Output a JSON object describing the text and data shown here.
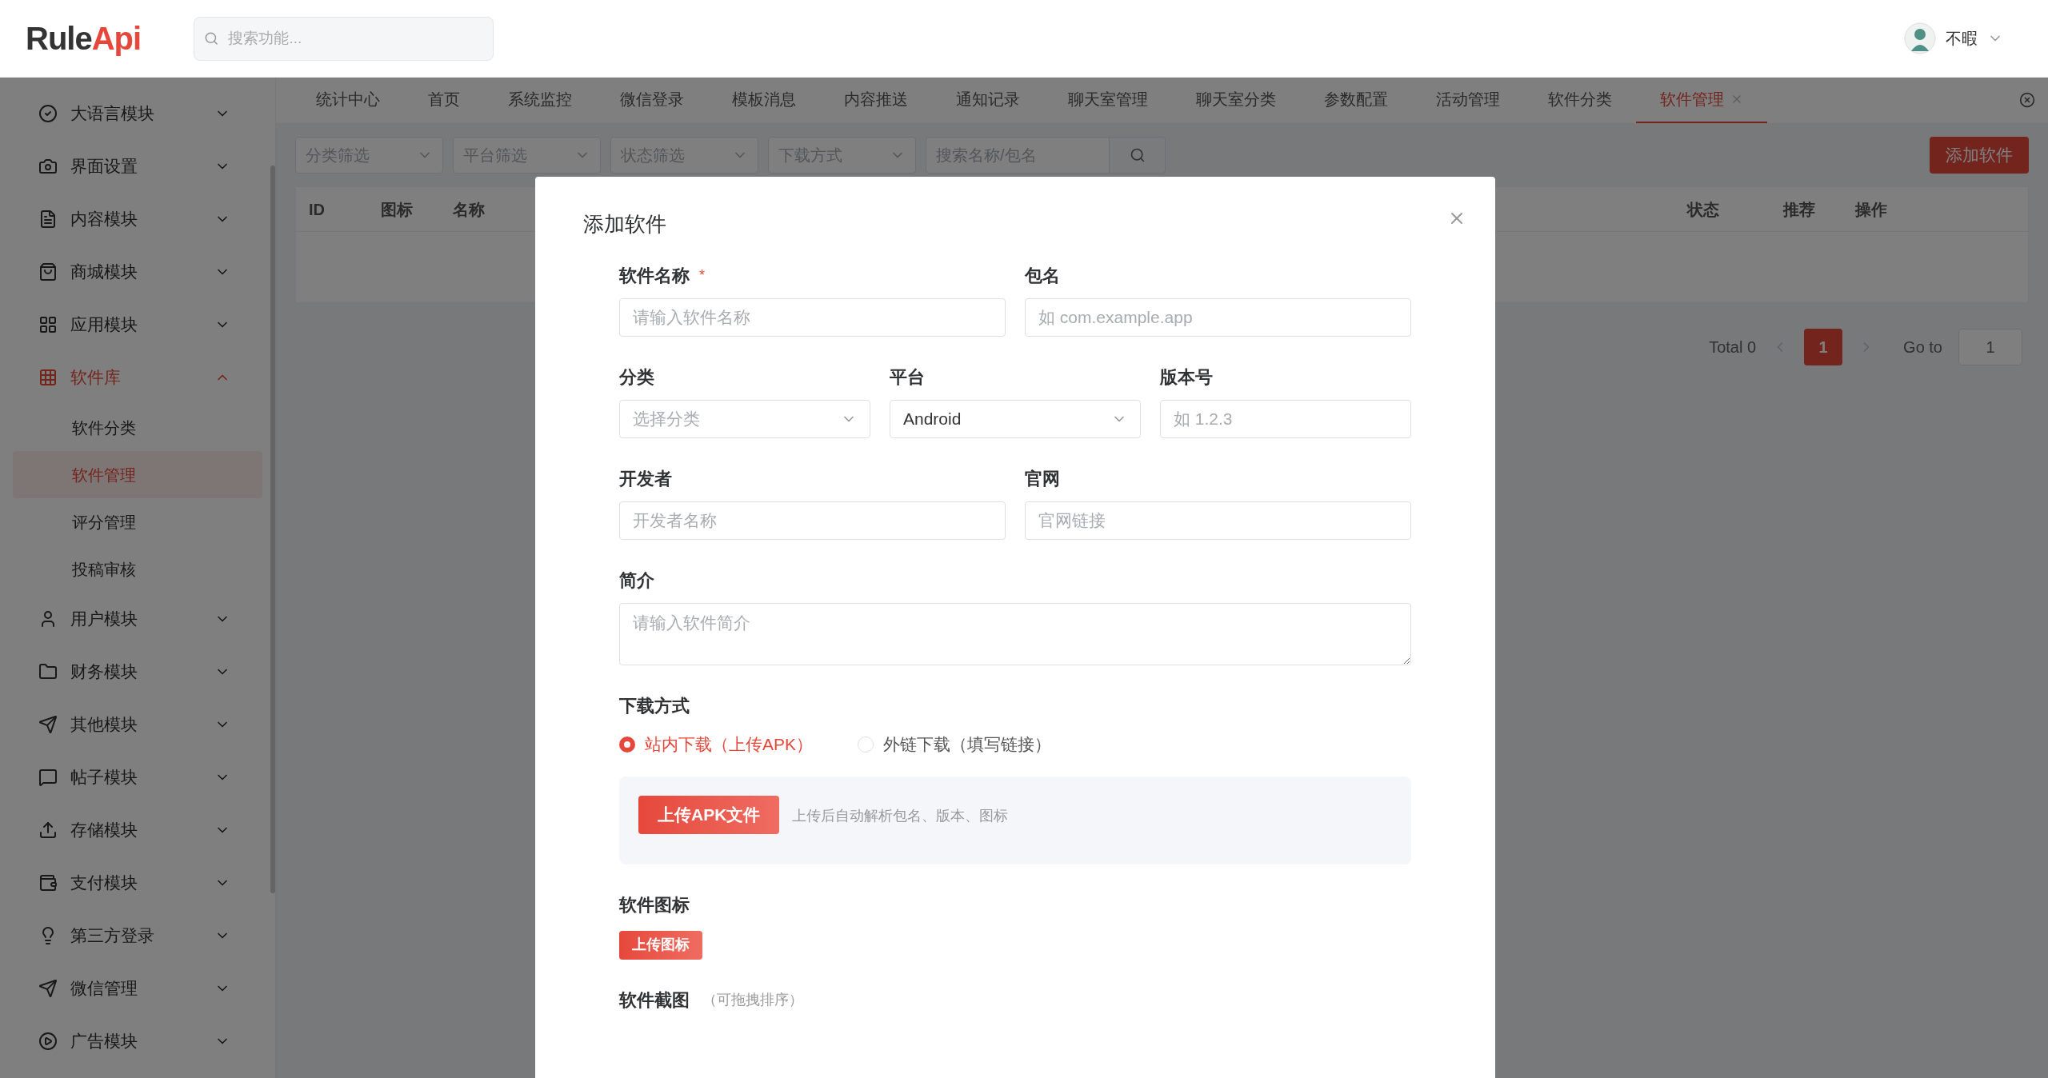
{
  "header": {
    "logo_primary": "Rule",
    "logo_accent": "Api",
    "search": {
      "placeholder": "搜索功能..."
    },
    "user": {
      "name": "不暇"
    }
  },
  "sidebar": {
    "items": [
      {
        "label": "大语言模块",
        "expanded": false,
        "selected": false
      },
      {
        "label": "界面设置",
        "expanded": false,
        "selected": false
      },
      {
        "label": "内容模块",
        "expanded": false,
        "selected": false
      },
      {
        "label": "商城模块",
        "expanded": false,
        "selected": false
      },
      {
        "label": "应用模块",
        "expanded": false,
        "selected": false
      },
      {
        "label": "软件库",
        "expanded": true,
        "selected": true,
        "children": [
          {
            "label": "软件分类",
            "selected": false
          },
          {
            "label": "软件管理",
            "selected": true
          },
          {
            "label": "评分管理",
            "selected": false
          },
          {
            "label": "投稿审核",
            "selected": false
          }
        ]
      },
      {
        "label": "用户模块",
        "expanded": false,
        "selected": false
      },
      {
        "label": "财务模块",
        "expanded": false,
        "selected": false
      },
      {
        "label": "其他模块",
        "expanded": false,
        "selected": false
      },
      {
        "label": "帖子模块",
        "expanded": false,
        "selected": false
      },
      {
        "label": "存储模块",
        "expanded": false,
        "selected": false
      },
      {
        "label": "支付模块",
        "expanded": false,
        "selected": false
      },
      {
        "label": "第三方登录",
        "expanded": false,
        "selected": false
      },
      {
        "label": "微信管理",
        "expanded": false,
        "selected": false
      },
      {
        "label": "广告模块",
        "expanded": false,
        "selected": false
      }
    ]
  },
  "tabs": [
    {
      "label": "统计中心",
      "selected": false
    },
    {
      "label": "首页",
      "selected": false
    },
    {
      "label": "系统监控",
      "selected": false
    },
    {
      "label": "微信登录",
      "selected": false
    },
    {
      "label": "模板消息",
      "selected": false
    },
    {
      "label": "内容推送",
      "selected": false
    },
    {
      "label": "通知记录",
      "selected": false
    },
    {
      "label": "聊天室管理",
      "selected": false
    },
    {
      "label": "聊天室分类",
      "selected": false
    },
    {
      "label": "参数配置",
      "selected": false
    },
    {
      "label": "活动管理",
      "selected": false
    },
    {
      "label": "软件分类",
      "selected": false
    },
    {
      "label": "软件管理",
      "selected": true
    }
  ],
  "filters": [
    {
      "placeholder": "分类筛选"
    },
    {
      "placeholder": "平台筛选"
    },
    {
      "placeholder": "状态筛选"
    },
    {
      "placeholder": "下载方式"
    }
  ],
  "search_filter": {
    "placeholder": "搜索名称/包名"
  },
  "add_button": "添加软件",
  "table": {
    "columns": [
      "ID",
      "图标",
      "名称",
      "状态",
      "推荐",
      "操作"
    ]
  },
  "pagination": {
    "total": "Total 0",
    "pages": [
      {
        "label": "1",
        "selected": true
      }
    ],
    "goto_label": "Go to",
    "goto_value": "1"
  },
  "dialog": {
    "title": "添加软件",
    "rows": [
      [
        {
          "kind": "input",
          "label": "软件名称",
          "required_mark": "*",
          "placeholder": "请输入软件名称"
        },
        {
          "kind": "input",
          "label": "包名",
          "placeholder": "如 com.example.app"
        }
      ],
      [
        {
          "kind": "select",
          "label": "分类",
          "placeholder": "选择分类"
        },
        {
          "kind": "select",
          "label": "平台",
          "value": "Android"
        },
        {
          "kind": "input",
          "label": "版本号",
          "placeholder": "如 1.2.3"
        }
      ],
      [
        {
          "kind": "input",
          "label": "开发者",
          "placeholder": "开发者名称"
        },
        {
          "kind": "input",
          "label": "官网",
          "placeholder": "官网链接"
        }
      ],
      [
        {
          "kind": "textarea",
          "label": "简介",
          "placeholder": "请输入软件简介"
        }
      ]
    ],
    "download": {
      "label": "下载方式",
      "options": [
        {
          "label": "站内下载（上传APK）",
          "selected": true
        },
        {
          "label": "外链下载（填写链接）",
          "selected": false
        }
      ],
      "upload_button": "上传APK文件",
      "upload_hint": "上传后自动解析包名、版本、图标"
    },
    "icon_section": {
      "label": "软件图标",
      "button": "上传图标"
    },
    "screenshot_section": {
      "label": "软件截图",
      "hint": "（可拖拽排序）"
    }
  }
}
